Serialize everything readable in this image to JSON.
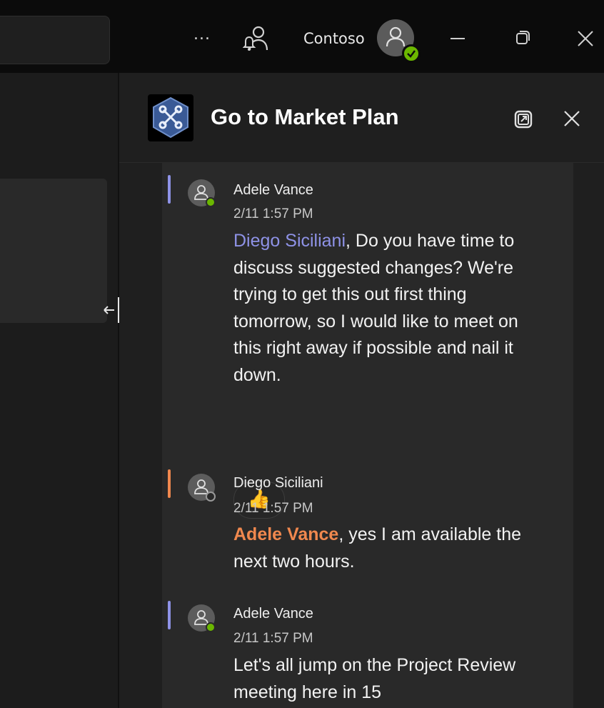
{
  "titlebar": {
    "more_label": "...",
    "org_name": "Contoso"
  },
  "pane": {
    "title": "Go to Market Plan"
  },
  "messages": [
    {
      "author": "Adele Vance",
      "time": "2/11 1:57 PM",
      "mention": "Diego Siciliani",
      "text": ", Do you have time to discuss suggested changes? We're trying to get this out first thing tomorrow, so I would like to meet on this right away if possible and nail it down.",
      "reaction": "👍"
    },
    {
      "author": "Diego Siciliani",
      "time": "2/11 1:57 PM",
      "mention": "Adele Vance",
      "text": ", yes I am available the next two hours."
    },
    {
      "author": "Adele Vance",
      "time": "2/11 1:57 PM",
      "text": "Let's all jump on the Project Review meeting here in 15"
    }
  ],
  "colors": {
    "accent_blue": "#8e92e6",
    "accent_orange": "#f0884e",
    "presence_available": "#6bb700"
  }
}
